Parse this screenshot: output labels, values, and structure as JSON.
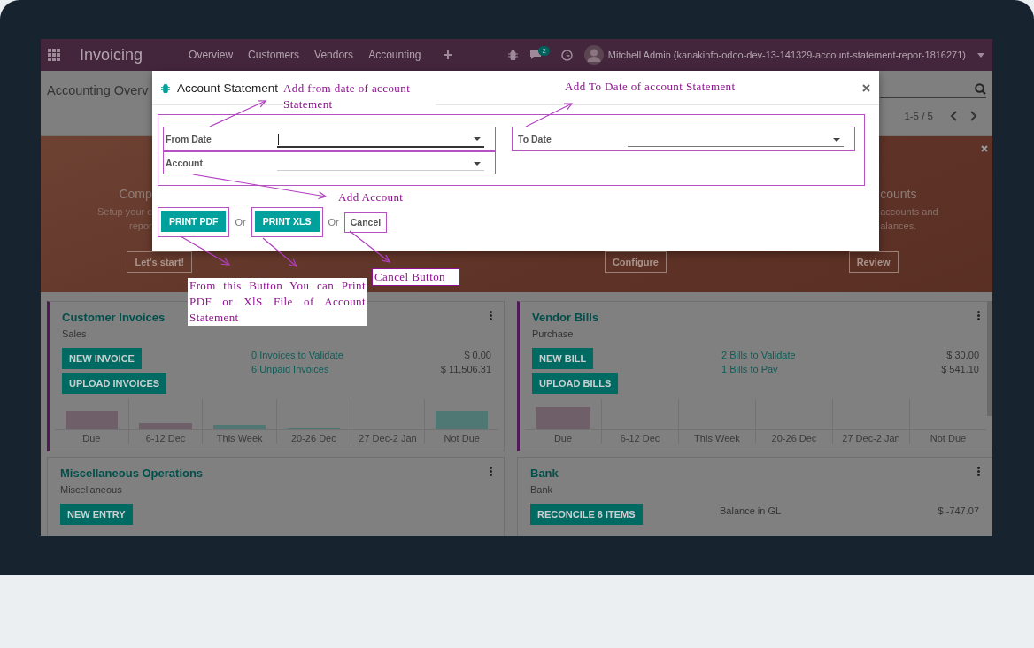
{
  "navbar": {
    "app_title": "Invoicing",
    "menu": [
      "Overview",
      "Customers",
      "Vendors",
      "Accounting"
    ],
    "chat_badge": "2",
    "user": "Mitchell Admin (kanakinfo-odoo-dev-13-141329-account-statement-repor-1816271)"
  },
  "control_panel": {
    "breadcrumb": "Accounting Overv",
    "pager": "1-5 / 5"
  },
  "banner": {
    "steps": [
      {
        "title": "Comp",
        "lines": [
          "Setup your c",
          "repor"
        ],
        "button": "Let's start!"
      },
      {
        "button": "Configure"
      },
      {
        "title": "counts",
        "lines": [
          "accounts and",
          "alances."
        ],
        "button": "Review"
      }
    ]
  },
  "journals": [
    {
      "title": "Customer Invoices",
      "subtitle": "Sales",
      "favorite": true,
      "buttons": [
        "NEW INVOICE",
        "UPLOAD INVOICES"
      ],
      "stats": [
        {
          "label": "0 Invoices to Validate",
          "amount": "$ 0.00",
          "kind": "link"
        },
        {
          "label": "6 Unpaid Invoices",
          "amount": "$ 11,506.31",
          "kind": "link"
        }
      ],
      "bars": [
        {
          "label": "Due",
          "kind": "past"
        },
        {
          "label": "6-12 Dec",
          "kind": "past"
        },
        {
          "label": "This Week",
          "kind": "future"
        },
        {
          "label": "20-26 Dec",
          "kind": "future"
        },
        {
          "label": "27 Dec-2 Jan",
          "kind": "future"
        },
        {
          "label": "Not Due",
          "kind": "future"
        }
      ]
    },
    {
      "title": "Vendor Bills",
      "subtitle": "Purchase",
      "favorite": true,
      "buttons": [
        "NEW BILL",
        "UPLOAD BILLS"
      ],
      "stats": [
        {
          "label": "2 Bills to Validate",
          "amount": "$ 30.00",
          "kind": "link"
        },
        {
          "label": "1 Bills to Pay",
          "amount": "$ 541.10",
          "kind": "link"
        }
      ],
      "bars": [
        {
          "label": "Due",
          "kind": "past"
        },
        {
          "label": "6-12 Dec",
          "kind": "past"
        },
        {
          "label": "This Week",
          "kind": "future"
        },
        {
          "label": "20-26 Dec",
          "kind": "future"
        },
        {
          "label": "27 Dec-2 Jan",
          "kind": "future"
        },
        {
          "label": "Not Due",
          "kind": "future"
        }
      ]
    },
    {
      "title": "Miscellaneous Operations",
      "subtitle": "Miscellaneous",
      "favorite": false,
      "buttons": [
        "NEW ENTRY"
      ]
    },
    {
      "title": "Bank",
      "subtitle": "Bank",
      "favorite": false,
      "buttons": [
        "RECONCILE 6 ITEMS"
      ],
      "stats": [
        {
          "label": "Balance in GL",
          "amount": "$ -747.07",
          "kind": "plain"
        }
      ]
    }
  ],
  "dialog": {
    "title": "Account Statement",
    "fields": [
      {
        "label": "From Date",
        "focused": true
      },
      {
        "label": "To Date",
        "focused": false
      },
      {
        "label": "Account",
        "focused": false
      }
    ],
    "footer": [
      {
        "kind": "primary",
        "label": "PRINT PDF"
      },
      {
        "kind": "text",
        "label": "Or"
      },
      {
        "kind": "primary",
        "label": "PRINT XLS"
      },
      {
        "kind": "text",
        "label": "Or"
      },
      {
        "kind": "secondary",
        "label": "Cancel"
      }
    ]
  },
  "annotations": [
    {
      "text": "Add from date of account Statement",
      "kind": "plain"
    },
    {
      "text": "Add To Date of account Statement",
      "kind": "plain"
    },
    {
      "text": "Add Account",
      "kind": "plain"
    },
    {
      "text": "From this Button You can Print PDF or XlS File of Account Statement",
      "kind": "boxed"
    },
    {
      "text": "Cancel Button",
      "kind": "boxed"
    }
  ]
}
